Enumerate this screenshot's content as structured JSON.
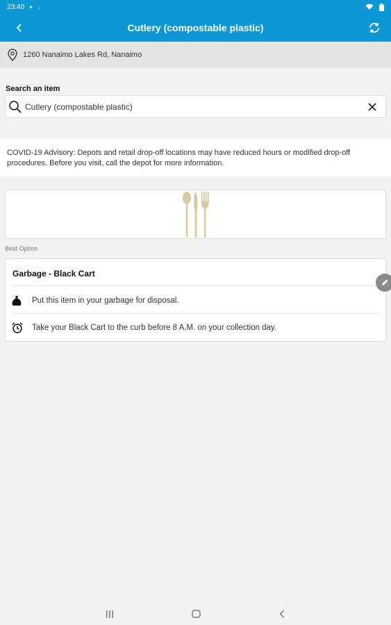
{
  "status_bar": {
    "time": "23:40"
  },
  "app_bar": {
    "title": "Cutlery (compostable plastic)"
  },
  "location": {
    "address": "1260 Nanaimo Lakes Rd, Nanaimo"
  },
  "search": {
    "label": "Search an item",
    "value": "Cutlery (compostable plastic)"
  },
  "advisory": {
    "text": "COVID-19 Advisory: Depots and retail drop-off locations may have reduced hours or modified drop-off procedures. Before you visit, call the depot for more information."
  },
  "best_option": {
    "label": "Best Option",
    "title": "Garbage - Black Cart",
    "rows": [
      {
        "icon": "garbage-bag-icon",
        "text": "Put this item in your garbage for disposal."
      },
      {
        "icon": "alarm-clock-icon",
        "text": "Take your Black Cart to the curb before 8 A.M. on your collection day."
      }
    ]
  },
  "colors": {
    "primary": "#0d97d4",
    "location_bar": "#e4e4e4",
    "background": "#f2f2f2",
    "fab": "#8a8a8a",
    "cutlery": "#d9c9a3"
  }
}
